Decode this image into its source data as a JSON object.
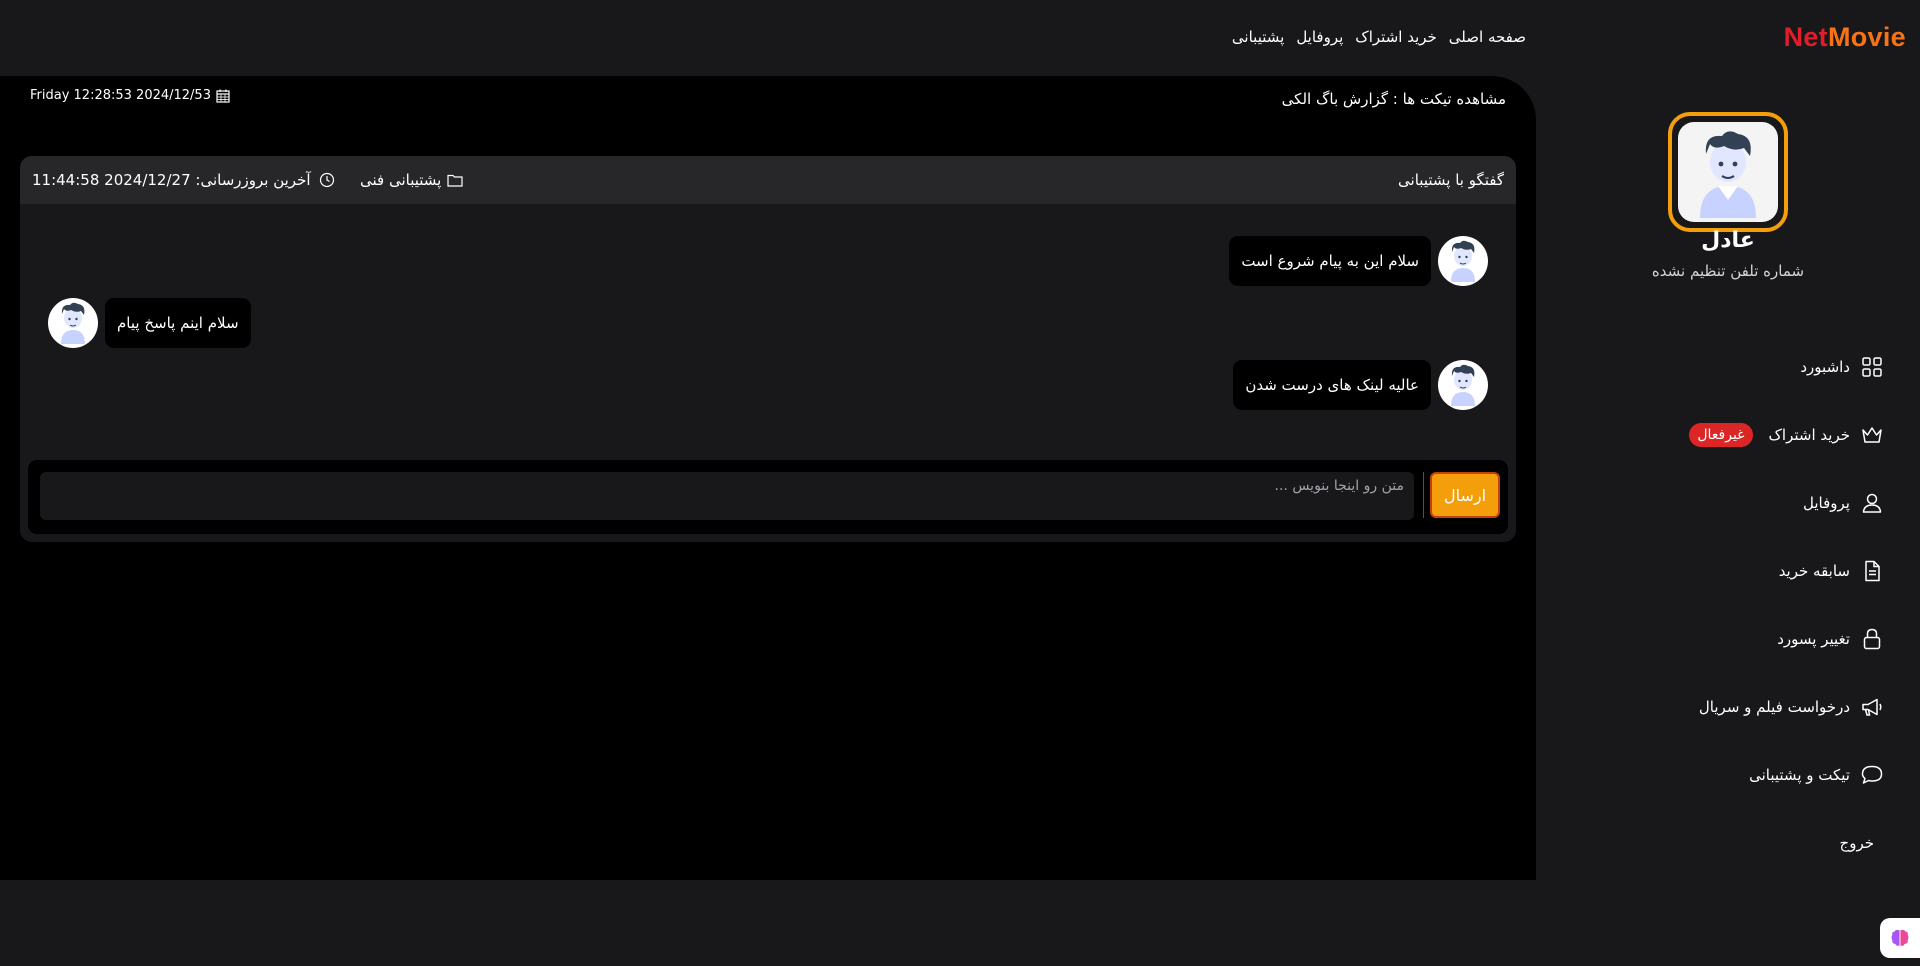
{
  "brand": {
    "part1": "Net",
    "part2": "Movie"
  },
  "nav": [
    {
      "label": "صفحه اصلی"
    },
    {
      "label": "خرید اشتراک"
    },
    {
      "label": "پروفایل"
    },
    {
      "label": "پشتیبانی"
    }
  ],
  "ticket": {
    "title": "مشاهده تیکت ها :  گزارش باگ الکی",
    "datetime": "Friday 12:28:53 2024/12/53"
  },
  "chat": {
    "header_title": "گفتگو با پشتیبانی",
    "category": "پشتیبانی فنی",
    "last_update": "آخرین بروزرسانی: 2024/12/27 11:44:58",
    "messages": [
      {
        "side": "right",
        "text": "سلام این به پیام شروع است"
      },
      {
        "side": "left",
        "text": "سلام اینم پاسخ پیام"
      },
      {
        "side": "right",
        "text": "عالیه لینک های درست شدن"
      }
    ],
    "input_placeholder": "متن رو اینجا بنویس ...",
    "send_label": "ارسال"
  },
  "user": {
    "name": "عادل",
    "phone_status": "شماره تلفن تنظیم نشده"
  },
  "sidebar": {
    "items": [
      {
        "label": "داشبورد",
        "icon": "grid-icon"
      },
      {
        "label": "خرید اشتراک",
        "icon": "crown-icon",
        "badge": "غیرفعال"
      },
      {
        "label": "پروفایل",
        "icon": "user-icon"
      },
      {
        "label": "سابقه خرید",
        "icon": "document-icon"
      },
      {
        "label": "تغییر پسورد",
        "icon": "lock-icon"
      },
      {
        "label": "درخواست فیلم و سریال",
        "icon": "megaphone-icon"
      },
      {
        "label": "تیکت و پشتیبانی",
        "icon": "chat-bubble-icon"
      },
      {
        "label": "خروج",
        "icon": ""
      }
    ]
  },
  "colors": {
    "accent": "#f59e0b",
    "danger": "#dc2626",
    "logo_red": "#e11d2a",
    "logo_orange": "#f97316"
  }
}
